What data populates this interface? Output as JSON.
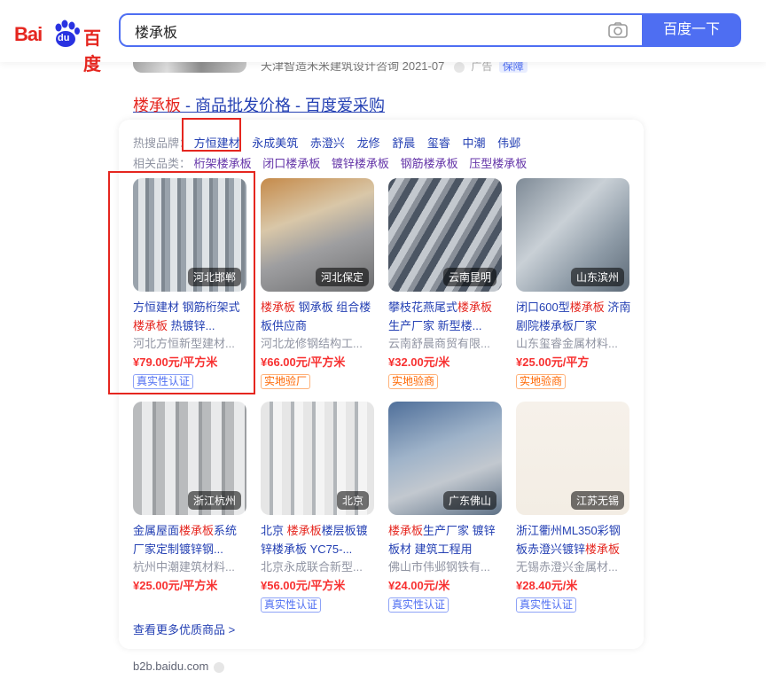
{
  "search": {
    "query": "楼承板",
    "button_label": "百度一下"
  },
  "logo": {
    "bai": "Bai",
    "du": "du",
    "cn": "百度"
  },
  "previous_result": {
    "meta": "天津智造禾米建筑设计咨询 2021-07",
    "badge": "保障"
  },
  "result": {
    "title_highlight": "楼承板",
    "title_rest": " - 商品批发价格 - 百度爱采购",
    "hot_brands_label": "热搜品牌：",
    "hot_brands": [
      "方恒建材",
      "永成美筑",
      "赤澄兴",
      "龙修",
      "舒晨",
      "玺睿",
      "中潮",
      "伟邺"
    ],
    "related_label": "相关品类：",
    "related_categories": [
      "桁架楼承板",
      "闭口楼承板",
      "镀锌楼承板",
      "钢筋楼承板",
      "压型楼承板"
    ],
    "products": [
      {
        "name_pre": "方恒建材 钢筋桁架式",
        "name_hl": "楼承板",
        "name_post": " 热镀锌...",
        "shop": "河北方恒新型建材...",
        "price": "¥79.00元/平方米",
        "badge": "真实性认证",
        "badge_type": "blue",
        "location": "河北邯郸"
      },
      {
        "name_pre": "",
        "name_hl": "楼承板",
        "name_post": " 钢承板 组合楼板供应商",
        "shop": "河北龙修钢结构工...",
        "price": "¥66.00元/平方米",
        "badge": "实地验厂",
        "badge_type": "orange",
        "location": "河北保定"
      },
      {
        "name_pre": "攀枝花燕尾式",
        "name_hl": "楼承板",
        "name_post": " 生产厂家 新型楼...",
        "shop": "云南舒晨商贸有限...",
        "price": "¥32.00元/米",
        "badge": "实地验商",
        "badge_type": "orange",
        "location": "云南昆明"
      },
      {
        "name_pre": "闭口600型",
        "name_hl": "楼承板",
        "name_post": " 济南剧院楼承板厂家",
        "shop": "山东玺睿金属材料...",
        "price": "¥25.00元/平方",
        "badge": "实地验商",
        "badge_type": "orange",
        "location": "山东滨州"
      },
      {
        "name_pre": "金属屋面",
        "name_hl": "楼承板",
        "name_post": "系统厂家定制镀锌钢...",
        "shop": "杭州中潮建筑材料...",
        "price": "¥25.00元/平方米",
        "badge": "",
        "badge_type": "none",
        "location": "浙江杭州"
      },
      {
        "name_pre": "北京 ",
        "name_hl": "楼承板",
        "name_post": "楼层板镀锌楼承板 YC75-...",
        "shop": "北京永成联合新型...",
        "price": "¥56.00元/平方米",
        "badge": "真实性认证",
        "badge_type": "blue",
        "location": "北京"
      },
      {
        "name_pre": "",
        "name_hl": "楼承板",
        "name_post": "生产厂家 镀锌板材 建筑工程用",
        "shop": "佛山市伟邺钢铁有...",
        "price": "¥24.00元/米",
        "badge": "真实性认证",
        "badge_type": "blue",
        "location": "广东佛山"
      },
      {
        "name_pre": "浙江衢州ML350彩钢板赤澄兴镀锌",
        "name_hl": "楼承板",
        "name_post": "",
        "shop": "无锡赤澄兴金属材...",
        "price": "¥28.40元/米",
        "badge": "真实性认证",
        "badge_type": "blue",
        "location": "江苏无锡"
      }
    ],
    "more_link": "查看更多优质商品 >",
    "source_url": "b2b.baidu.com"
  },
  "colors": {
    "accent": "#4e6ef2",
    "link": "#2440b3",
    "highlight": "#e5261f",
    "price": "#f73131"
  }
}
